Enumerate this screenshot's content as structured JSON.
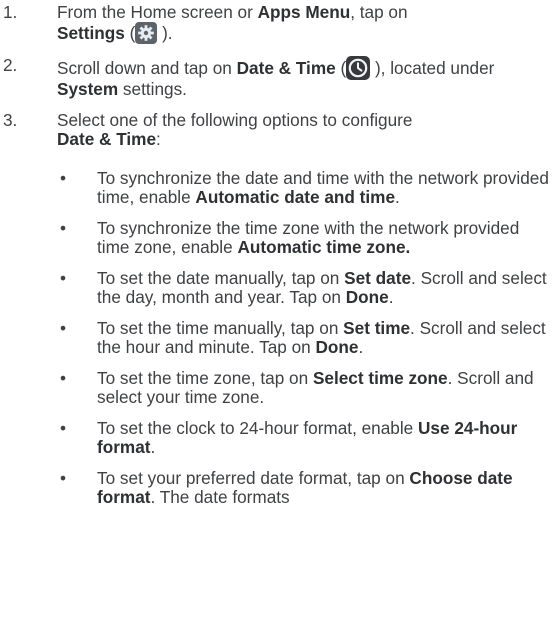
{
  "steps": [
    {
      "number": "1.",
      "parts": [
        "From the Home screen or ",
        "Apps Menu",
        ", tap on ",
        "Settings",
        " (",
        " )."
      ]
    },
    {
      "number": "2.",
      "parts": [
        "Scroll down and tap on ",
        "Date & Time",
        " (",
        " ), located under ",
        "System",
        " settings."
      ]
    },
    {
      "number": "3.",
      "parts": [
        "Select one of the following options to configure ",
        "Date & Time",
        ":"
      ]
    }
  ],
  "bullet_symbol": "•",
  "bullets": [
    {
      "parts": [
        "To synchronize the date and time with the network provided time, enable ",
        "Automatic date and time",
        "."
      ]
    },
    {
      "parts": [
        "To synchronize the time zone with the network provided time zone, enable ",
        "Automatic time zone."
      ]
    },
    {
      "parts": [
        "To set the date manually, tap on ",
        "Set date",
        ". Scroll and select the day, month and year. Tap on ",
        "Done",
        "."
      ]
    },
    {
      "parts": [
        "To set the time manually, tap on ",
        "Set time",
        ". Scroll and select the hour and minute. Tap on ",
        "Done",
        "."
      ]
    },
    {
      "parts": [
        "To set the time zone, tap on ",
        "Select time zone",
        ". Scroll and select your time zone."
      ]
    },
    {
      "parts": [
        "To set the clock to 24-hour format, enable ",
        "Use 24-hour format",
        "."
      ]
    },
    {
      "parts": [
        "To set your preferred date format, tap on ",
        "Choose date format",
        ". The date formats"
      ]
    }
  ],
  "icons": {
    "settings": "gear-icon",
    "date_time": "clock-icon"
  }
}
